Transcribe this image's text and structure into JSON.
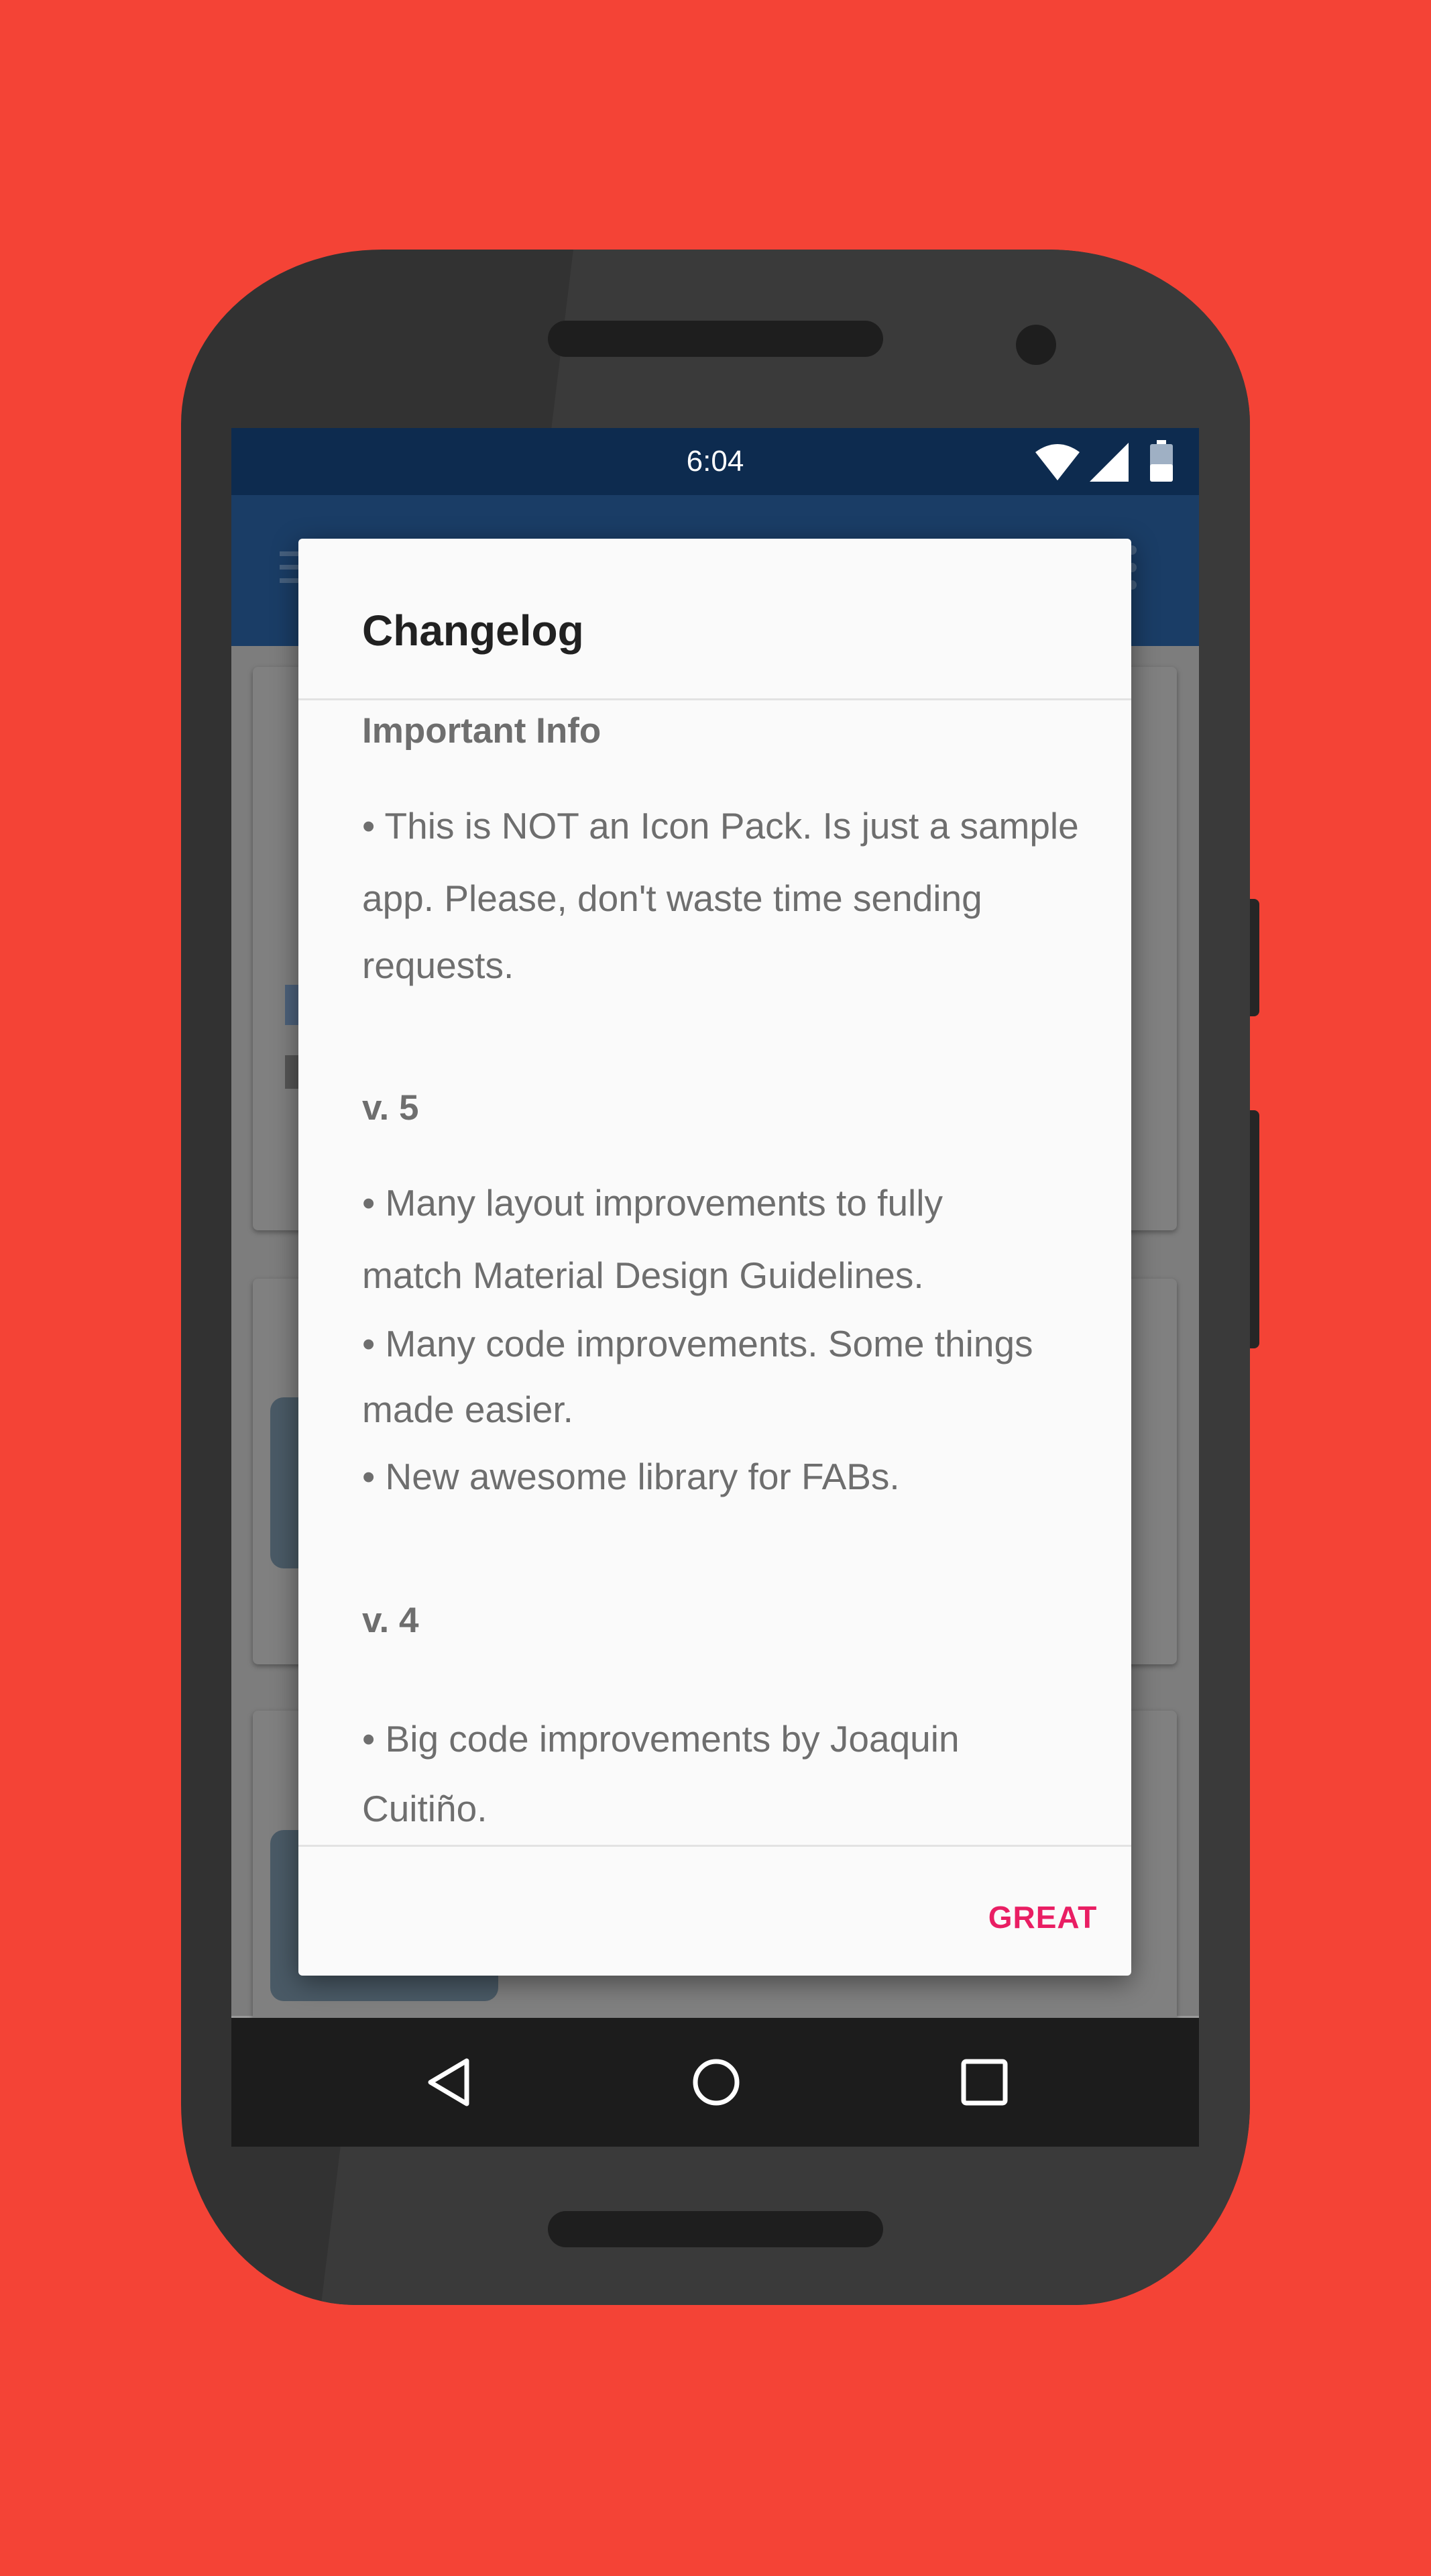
{
  "status_bar": {
    "time": "6:04",
    "icons": [
      "wifi-icon",
      "cellular-signal-icon",
      "battery-icon"
    ]
  },
  "toolbar": {
    "icons": [
      "menu-icon",
      "more-vert-icon"
    ]
  },
  "dialog": {
    "title": "Changelog",
    "sections": [
      {
        "heading": "Important Info",
        "lines": [
          "• This is NOT an Icon Pack. Is just a sample",
          "app. Please, don't waste time sending",
          "requests."
        ]
      },
      {
        "heading": "v. 5",
        "lines": [
          "• Many layout improvements to fully",
          "match Material Design Guidelines.",
          "• Many code improvements. Some things",
          "made easier.",
          "• New awesome library for FABs."
        ]
      },
      {
        "heading": "v. 4",
        "lines": [
          "• Big code improvements by Joaquin",
          "Cuitiño."
        ]
      }
    ],
    "positive_button": "GREAT"
  },
  "nav_bar": {
    "icons": [
      "back-icon",
      "home-icon",
      "recents-icon"
    ]
  },
  "colors": {
    "background": "#f44336",
    "status_bar": "#0d2b4f",
    "toolbar": "#1a3d66",
    "dialog": "#fafafa",
    "accent": "#e91e63"
  }
}
